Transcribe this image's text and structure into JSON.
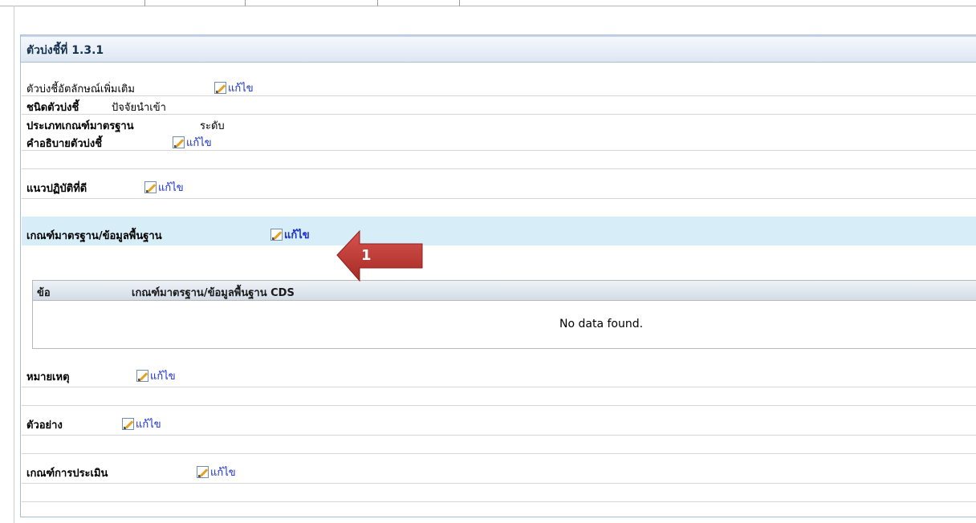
{
  "panel": {
    "title": "ตัวบ่งชี้ที่   1.3.1"
  },
  "rows": {
    "extra_identity": {
      "label": "ตัวบ่งชี้อัตลักษณ์เพิ่มเติม",
      "edit": "แก้ไข"
    },
    "indicator_type": {
      "label": "ชนิดตัวบ่งชี้",
      "value": "ปัจจัยนำเข้า"
    },
    "criteria_type": {
      "label": "ประเภทเกณฑ์มาตรฐาน",
      "value": "ระดับ"
    },
    "description": {
      "label": "คำอธิบายตัวบ่งชี้",
      "edit": "แก้ไข"
    },
    "best_practice": {
      "label": "แนวปฏิบัติที่ดี",
      "edit": "แก้ไข"
    },
    "standard_base": {
      "label": "เกณฑ์มาตรฐาน/ข้อมูลพื้นฐาน",
      "edit": "แก้ไข"
    },
    "note": {
      "label": "หมายเหตุ",
      "edit": "แก้ไข"
    },
    "example": {
      "label": "ตัวอย่าง",
      "edit": "แก้ไข"
    },
    "evaluation": {
      "label": "เกณฑ์การประเมิน",
      "edit": "แก้ไข"
    }
  },
  "subtable": {
    "columns": [
      "ข้อ",
      "เกณฑ์มาตรฐาน/ข้อมูลพื้นฐาน CDS"
    ],
    "empty_message": "No data found."
  },
  "callout": {
    "number": "1",
    "color": "#c0392b"
  },
  "colors": {
    "link": "#1a2fd0",
    "header_bg": "#dde7f2",
    "highlight_row": "#d7eef8"
  }
}
